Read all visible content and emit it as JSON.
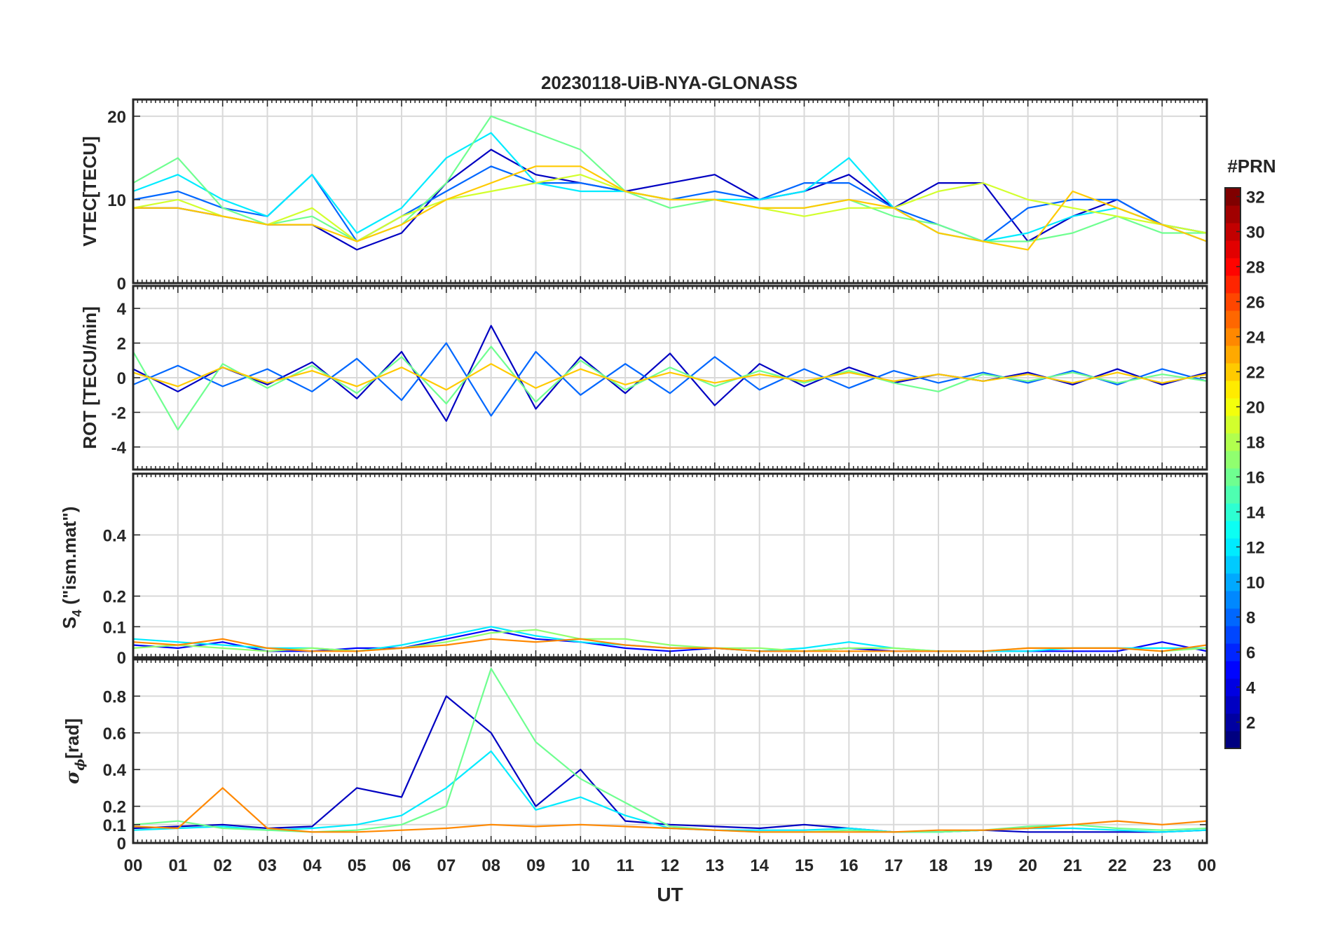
{
  "title": "20230118-UiB-NYA-GLONASS",
  "xlabel": "UT",
  "x_ticks": [
    "00",
    "01",
    "02",
    "03",
    "04",
    "05",
    "06",
    "07",
    "08",
    "09",
    "10",
    "11",
    "12",
    "13",
    "14",
    "15",
    "16",
    "17",
    "18",
    "19",
    "20",
    "21",
    "22",
    "23",
    "00"
  ],
  "colorbar": {
    "label": "#PRN",
    "ticks": [
      2,
      4,
      6,
      8,
      10,
      12,
      14,
      16,
      18,
      20,
      22,
      24,
      26,
      28,
      30,
      32
    ],
    "range": [
      1,
      32
    ],
    "colormap": "jet",
    "colors": [
      "#000080",
      "#0000ff",
      "#0080ff",
      "#00ffff",
      "#80ff80",
      "#ffff00",
      "#ff8000",
      "#ff0000",
      "#800000"
    ]
  },
  "panels": [
    {
      "id": "vtec",
      "ylabel": "VTEC[TECU]",
      "ylim": [
        0,
        22
      ],
      "yticks": [
        0,
        10,
        20
      ]
    },
    {
      "id": "rot",
      "ylabel": "ROT [TECU/min]",
      "ylim": [
        -5.3,
        5.3
      ],
      "yticks": [
        -4,
        -2,
        0,
        2,
        4
      ]
    },
    {
      "id": "s4",
      "ylabel_main": "S",
      "ylabel_sub": "4",
      "ylabel_rest": " (\"ism.mat\")",
      "ylim": [
        0,
        0.6
      ],
      "yticks": [
        0,
        0.1,
        0.2,
        0.4
      ]
    },
    {
      "id": "sigphi",
      "ylabel_main": "σ",
      "ylabel_sub": "ϕ",
      "ylabel_rest": "[rad]",
      "ylim": [
        0,
        1.0
      ],
      "yticks": [
        0,
        0.1,
        0.2,
        0.4,
        0.6,
        0.8
      ]
    }
  ],
  "chart_data": [
    {
      "type": "line",
      "title": "20230118-UiB-NYA-GLONASS",
      "xlabel": "",
      "ylabel": "VTEC[TECU]",
      "xlim": [
        0,
        24
      ],
      "ylim": [
        0,
        22
      ],
      "grid": true,
      "series": [
        {
          "prn": 3,
          "x": [
            0,
            1,
            2,
            3,
            4,
            5,
            6,
            7,
            8,
            9,
            10,
            11,
            12,
            13,
            14,
            15,
            16,
            17,
            18,
            19,
            20,
            21,
            22,
            23,
            24
          ],
          "values": [
            9,
            9,
            8,
            7,
            7,
            4,
            6,
            12,
            16,
            13,
            12,
            11,
            12,
            13,
            10,
            11,
            13,
            9,
            12,
            12,
            5,
            8,
            10,
            7,
            6
          ]
        },
        {
          "prn": 8,
          "x": [
            0,
            1,
            2,
            3,
            4,
            5,
            6,
            7,
            8,
            9,
            10,
            11,
            12,
            13,
            14,
            15,
            16,
            17,
            18,
            19,
            20,
            21,
            22,
            23,
            24
          ],
          "values": [
            10,
            11,
            9,
            8,
            13,
            5,
            8,
            11,
            14,
            12,
            12,
            11,
            10,
            11,
            10,
            12,
            12,
            9,
            7,
            5,
            9,
            10,
            10,
            7,
            5
          ]
        },
        {
          "prn": 12,
          "x": [
            0,
            1,
            2,
            3,
            4,
            5,
            6,
            7,
            8,
            9,
            10,
            11,
            12,
            13,
            14,
            15,
            16,
            17,
            18,
            19,
            20,
            21,
            22,
            23,
            24
          ],
          "values": [
            11,
            13,
            10,
            8,
            13,
            6,
            9,
            15,
            18,
            12,
            11,
            11,
            10,
            10,
            10,
            11,
            15,
            9,
            6,
            5,
            6,
            8,
            9,
            7,
            6
          ]
        },
        {
          "prn": 16,
          "x": [
            0,
            1,
            2,
            3,
            4,
            5,
            6,
            7,
            8,
            9,
            10,
            11,
            12,
            13,
            14,
            15,
            16,
            17,
            18,
            19,
            20,
            21,
            22,
            23,
            24
          ],
          "values": [
            12,
            15,
            9,
            7,
            8,
            5,
            7,
            12,
            20,
            18,
            16,
            11,
            9,
            10,
            9,
            9,
            10,
            8,
            7,
            5,
            5,
            6,
            8,
            6,
            6
          ]
        },
        {
          "prn": 19,
          "x": [
            0,
            1,
            2,
            3,
            4,
            5,
            6,
            7,
            8,
            9,
            10,
            11,
            12,
            13,
            14,
            15,
            16,
            17,
            18,
            19,
            20,
            21,
            22,
            23,
            24
          ],
          "values": [
            9,
            10,
            8,
            7,
            9,
            5,
            8,
            10,
            11,
            12,
            13,
            11,
            10,
            10,
            9,
            8,
            9,
            9,
            11,
            12,
            10,
            9,
            8,
            7,
            6
          ]
        },
        {
          "prn": 22,
          "x": [
            0,
            1,
            2,
            3,
            4,
            5,
            6,
            7,
            8,
            9,
            10,
            11,
            12,
            13,
            14,
            15,
            16,
            17,
            18,
            19,
            20,
            21,
            22,
            23,
            24
          ],
          "values": [
            9,
            9,
            8,
            7,
            7,
            5,
            7,
            10,
            12,
            14,
            14,
            11,
            10,
            10,
            9,
            9,
            10,
            9,
            6,
            5,
            4,
            11,
            9,
            7,
            5
          ]
        }
      ]
    },
    {
      "type": "line",
      "title": "",
      "xlabel": "",
      "ylabel": "ROT [TECU/min]",
      "xlim": [
        0,
        24
      ],
      "ylim": [
        -5.3,
        5.3
      ],
      "grid": true,
      "series": [
        {
          "prn": 3,
          "x": [
            0,
            1,
            2,
            3,
            4,
            5,
            6,
            7,
            8,
            9,
            10,
            11,
            12,
            13,
            14,
            15,
            16,
            17,
            18,
            19,
            20,
            21,
            22,
            23,
            24
          ],
          "values": [
            0.5,
            -0.8,
            0.6,
            -0.4,
            0.9,
            -1.2,
            1.5,
            -2.5,
            3.0,
            -1.8,
            1.2,
            -0.9,
            1.4,
            -1.6,
            0.8,
            -0.5,
            0.6,
            -0.3,
            0.2,
            -0.2,
            0.3,
            -0.4,
            0.5,
            -0.4,
            0.3
          ]
        },
        {
          "prn": 8,
          "x": [
            0,
            1,
            2,
            3,
            4,
            5,
            6,
            7,
            8,
            9,
            10,
            11,
            12,
            13,
            14,
            15,
            16,
            17,
            18,
            19,
            20,
            21,
            22,
            23,
            24
          ],
          "values": [
            -0.4,
            0.7,
            -0.5,
            0.5,
            -0.8,
            1.1,
            -1.3,
            2.0,
            -2.2,
            1.5,
            -1.0,
            0.8,
            -0.9,
            1.2,
            -0.7,
            0.5,
            -0.6,
            0.4,
            -0.3,
            0.3,
            -0.3,
            0.4,
            -0.4,
            0.5,
            -0.2
          ]
        },
        {
          "prn": 16,
          "x": [
            0,
            1,
            2,
            3,
            4,
            5,
            6,
            7,
            8,
            9,
            10,
            11,
            12,
            13,
            14,
            15,
            16,
            17,
            18,
            19,
            20,
            21,
            22,
            23,
            24
          ],
          "values": [
            1.5,
            -3.0,
            0.8,
            -0.6,
            0.7,
            -0.9,
            1.2,
            -1.5,
            1.8,
            -1.4,
            1.0,
            -0.7,
            0.6,
            -0.5,
            0.4,
            -0.3,
            0.4,
            -0.3,
            -0.8,
            0.2,
            -0.2,
            0.3,
            -0.3,
            0.2,
            -0.2
          ]
        },
        {
          "prn": 22,
          "x": [
            0,
            1,
            2,
            3,
            4,
            5,
            6,
            7,
            8,
            9,
            10,
            11,
            12,
            13,
            14,
            15,
            16,
            17,
            18,
            19,
            20,
            21,
            22,
            23,
            24
          ],
          "values": [
            0.3,
            -0.5,
            0.6,
            -0.3,
            0.4,
            -0.5,
            0.6,
            -0.7,
            0.8,
            -0.6,
            0.5,
            -0.4,
            0.3,
            -0.3,
            0.2,
            -0.2,
            0.3,
            -0.2,
            0.2,
            -0.2,
            0.2,
            -0.3,
            0.3,
            -0.3,
            0.2
          ]
        }
      ]
    },
    {
      "type": "line",
      "title": "",
      "xlabel": "",
      "ylabel": "S4 (\"ism.mat\")",
      "xlim": [
        0,
        24
      ],
      "ylim": [
        0,
        0.6
      ],
      "grid": true,
      "series": [
        {
          "prn": 5,
          "x": [
            0,
            1,
            2,
            3,
            4,
            5,
            6,
            7,
            8,
            9,
            10,
            11,
            12,
            13,
            14,
            15,
            16,
            17,
            18,
            19,
            20,
            21,
            22,
            23,
            24
          ],
          "values": [
            0.04,
            0.03,
            0.05,
            0.02,
            0.02,
            0.03,
            0.03,
            0.06,
            0.09,
            0.06,
            0.05,
            0.03,
            0.02,
            0.03,
            0.02,
            0.02,
            0.03,
            0.02,
            0.02,
            0.02,
            0.02,
            0.02,
            0.02,
            0.05,
            0.02
          ]
        },
        {
          "prn": 12,
          "x": [
            0,
            1,
            2,
            3,
            4,
            5,
            6,
            7,
            8,
            9,
            10,
            11,
            12,
            13,
            14,
            15,
            16,
            17,
            18,
            19,
            20,
            21,
            22,
            23,
            24
          ],
          "values": [
            0.06,
            0.05,
            0.04,
            0.03,
            0.03,
            0.02,
            0.04,
            0.07,
            0.1,
            0.07,
            0.05,
            0.04,
            0.03,
            0.03,
            0.02,
            0.03,
            0.05,
            0.03,
            0.02,
            0.02,
            0.02,
            0.03,
            0.03,
            0.03,
            0.03
          ]
        },
        {
          "prn": 17,
          "x": [
            0,
            1,
            2,
            3,
            4,
            5,
            6,
            7,
            8,
            9,
            10,
            11,
            12,
            13,
            14,
            15,
            16,
            17,
            18,
            19,
            20,
            21,
            22,
            23,
            24
          ],
          "values": [
            0.03,
            0.04,
            0.03,
            0.02,
            0.03,
            0.02,
            0.03,
            0.05,
            0.08,
            0.09,
            0.06,
            0.06,
            0.04,
            0.03,
            0.03,
            0.02,
            0.03,
            0.03,
            0.02,
            0.02,
            0.03,
            0.03,
            0.03,
            0.02,
            0.03
          ]
        },
        {
          "prn": 24,
          "x": [
            0,
            1,
            2,
            3,
            4,
            5,
            6,
            7,
            8,
            9,
            10,
            11,
            12,
            13,
            14,
            15,
            16,
            17,
            18,
            19,
            20,
            21,
            22,
            23,
            24
          ],
          "values": [
            0.05,
            0.04,
            0.06,
            0.03,
            0.02,
            0.02,
            0.03,
            0.04,
            0.06,
            0.05,
            0.06,
            0.04,
            0.03,
            0.03,
            0.02,
            0.02,
            0.02,
            0.02,
            0.02,
            0.02,
            0.03,
            0.03,
            0.03,
            0.02,
            0.04
          ]
        }
      ]
    },
    {
      "type": "line",
      "title": "",
      "xlabel": "UT",
      "ylabel": "σϕ[rad]",
      "xlim": [
        0,
        24
      ],
      "ylim": [
        0,
        1.0
      ],
      "grid": true,
      "series": [
        {
          "prn": 3,
          "x": [
            0,
            1,
            2,
            3,
            4,
            5,
            6,
            7,
            8,
            9,
            10,
            11,
            12,
            13,
            14,
            15,
            16,
            17,
            18,
            19,
            20,
            21,
            22,
            23,
            24
          ],
          "values": [
            0.08,
            0.09,
            0.1,
            0.08,
            0.09,
            0.3,
            0.25,
            0.8,
            0.6,
            0.2,
            0.4,
            0.12,
            0.1,
            0.09,
            0.08,
            0.1,
            0.08,
            0.06,
            0.06,
            0.07,
            0.06,
            0.06,
            0.06,
            0.06,
            0.07
          ]
        },
        {
          "prn": 12,
          "x": [
            0,
            1,
            2,
            3,
            4,
            5,
            6,
            7,
            8,
            9,
            10,
            11,
            12,
            13,
            14,
            15,
            16,
            17,
            18,
            19,
            20,
            21,
            22,
            23,
            24
          ],
          "values": [
            0.07,
            0.08,
            0.09,
            0.07,
            0.08,
            0.1,
            0.15,
            0.3,
            0.5,
            0.18,
            0.25,
            0.15,
            0.08,
            0.07,
            0.07,
            0.07,
            0.08,
            0.06,
            0.06,
            0.07,
            0.08,
            0.08,
            0.07,
            0.06,
            0.07
          ]
        },
        {
          "prn": 16,
          "x": [
            0,
            1,
            2,
            3,
            4,
            5,
            6,
            7,
            8,
            9,
            10,
            11,
            12,
            13,
            14,
            15,
            16,
            17,
            18,
            19,
            20,
            21,
            22,
            23,
            24
          ],
          "values": [
            0.1,
            0.12,
            0.08,
            0.07,
            0.06,
            0.07,
            0.1,
            0.2,
            0.95,
            0.55,
            0.35,
            0.22,
            0.09,
            0.07,
            0.06,
            0.06,
            0.07,
            0.06,
            0.06,
            0.07,
            0.09,
            0.1,
            0.08,
            0.07,
            0.08
          ]
        },
        {
          "prn": 24,
          "x": [
            0,
            1,
            2,
            3,
            4,
            5,
            6,
            7,
            8,
            9,
            10,
            11,
            12,
            13,
            14,
            15,
            16,
            17,
            18,
            19,
            20,
            21,
            22,
            23,
            24
          ],
          "values": [
            0.09,
            0.08,
            0.3,
            0.08,
            0.06,
            0.06,
            0.07,
            0.08,
            0.1,
            0.09,
            0.1,
            0.09,
            0.08,
            0.07,
            0.06,
            0.06,
            0.06,
            0.06,
            0.07,
            0.07,
            0.08,
            0.1,
            0.12,
            0.1,
            0.12
          ]
        }
      ]
    }
  ]
}
